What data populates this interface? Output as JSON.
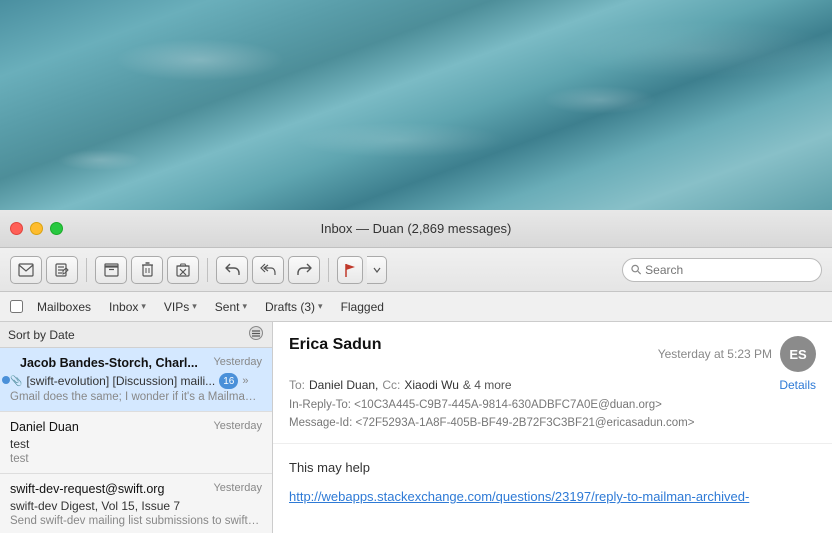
{
  "desktop": {
    "bg_description": "ocean water desktop background"
  },
  "window": {
    "title": "Inbox — Duan (2,869 messages)"
  },
  "traffic_lights": {
    "red": "close",
    "yellow": "minimize",
    "green": "maximize"
  },
  "toolbar": {
    "buttons": [
      {
        "id": "compose-new",
        "icon": "✏",
        "label": "Compose"
      },
      {
        "id": "compose-pencil",
        "icon": "✏",
        "label": "New Message"
      },
      {
        "id": "archive",
        "icon": "⬜",
        "label": "Archive"
      },
      {
        "id": "trash",
        "icon": "🗑",
        "label": "Delete"
      },
      {
        "id": "move",
        "icon": "📁",
        "label": "Move"
      },
      {
        "id": "reply",
        "icon": "↩",
        "label": "Reply"
      },
      {
        "id": "reply-all",
        "icon": "↩↩",
        "label": "Reply All"
      },
      {
        "id": "forward",
        "icon": "↪",
        "label": "Forward"
      },
      {
        "id": "flag",
        "icon": "⚑",
        "label": "Flag"
      },
      {
        "id": "flag-menu",
        "icon": "▾",
        "label": "Flag Menu"
      }
    ],
    "search_placeholder": "Search"
  },
  "nav": {
    "mailboxes_label": "Mailboxes",
    "inbox_label": "Inbox",
    "inbox_count": "",
    "vips_label": "VIPs",
    "sent_label": "Sent",
    "drafts_label": "Drafts (3)",
    "flagged_label": "Flagged"
  },
  "message_list": {
    "sort_label": "Sort by Date",
    "sort_icon": "≡",
    "messages": [
      {
        "id": 1,
        "selected": true,
        "unread": true,
        "has_attachment": true,
        "sender": "Jacob Bandes-Storch, Charl...",
        "date": "Yesterday",
        "subject": "[swift-evolution] [Discussion] maili...",
        "badge": "16",
        "badge_type": "blue",
        "has_more": true,
        "preview": "Gmail does the same; I wonder if it's a Mailman feature/bug that triggers the spli..."
      },
      {
        "id": 2,
        "selected": false,
        "unread": false,
        "has_attachment": false,
        "sender": "Daniel Duan",
        "date": "Yesterday",
        "subject": "test",
        "badge": "",
        "badge_type": "",
        "has_more": false,
        "preview": "test"
      },
      {
        "id": 3,
        "selected": false,
        "unread": false,
        "has_attachment": false,
        "sender": "swift-dev-request@swift.org",
        "date": "Yesterday",
        "subject": "swift-dev Digest, Vol 15, Issue 7",
        "badge": "",
        "badge_type": "",
        "has_more": false,
        "preview": "Send swift-dev mailing list submissions to swift-dev@swift.org To subscribe or unsu..."
      }
    ]
  },
  "email": {
    "sender_name": "Erica Sadun",
    "date": "Yesterday at 5:23 PM",
    "avatar_initials": "ES",
    "avatar_bg": "#8b8b8b",
    "to_label": "To:",
    "to_name": "Daniel Duan,",
    "cc_label": "Cc:",
    "cc_name": "Xiaodi Wu",
    "cc_more": "& 4 more",
    "details_link": "Details",
    "meta_lines": [
      "In-Reply-To: <10C3A445-C9B7-445A-9814-630ADBFC7A0E@duan.org>",
      "Message-Id: <72F5293A-1A8F-405B-BF49-2B72F3C3BF21@ericasadun.com>"
    ],
    "body_intro": "This may help",
    "body_link": "http://webapps.stackexchange.com/questions/23197/reply-to-mailman-archived-"
  }
}
